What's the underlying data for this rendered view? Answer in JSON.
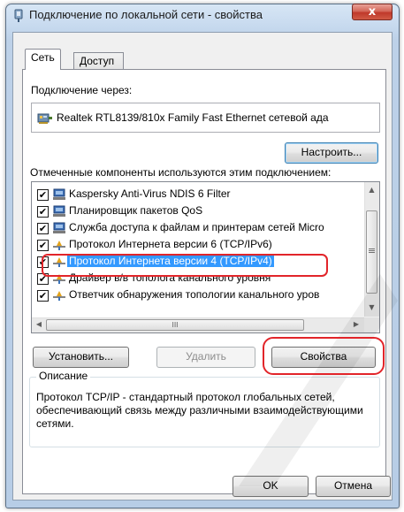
{
  "window": {
    "title": "Подключение по локальной сети - свойства",
    "close_glyph": "x"
  },
  "tabs": [
    {
      "label": "Сеть",
      "active": true
    },
    {
      "label": "Доступ",
      "active": false
    }
  ],
  "connection": {
    "label": "Подключение через:",
    "adapter": "Realtek RTL8139/810x Family Fast Ethernet сетевой ада",
    "configure_button": "Настроить..."
  },
  "components": {
    "label": "Отмеченные компоненты используются этим подключением:",
    "items": [
      {
        "label": "Kaspersky Anti-Virus NDIS 6 Filter",
        "checked": true,
        "icon": "network-client-icon",
        "selected": false
      },
      {
        "label": "Планировщик пакетов QoS",
        "checked": true,
        "icon": "network-client-icon",
        "selected": false
      },
      {
        "label": "Служба доступа к файлам и принтерам сетей Micro",
        "checked": true,
        "icon": "network-client-icon",
        "selected": false
      },
      {
        "label": "Протокол Интернета версии 6 (TCP/IPv6)",
        "checked": true,
        "icon": "protocol-icon",
        "selected": false
      },
      {
        "label": "Протокол Интернета версии 4 (TCP/IPv4)",
        "checked": true,
        "icon": "protocol-icon",
        "selected": true
      },
      {
        "label": "Драйвер в/в тополога канального уровня",
        "checked": true,
        "icon": "protocol-icon",
        "selected": false
      },
      {
        "label": "Ответчик обнаружения топологии канального уров",
        "checked": true,
        "icon": "protocol-icon",
        "selected": false
      }
    ],
    "check_glyph": "✔",
    "scroll_up": "▲",
    "scroll_down": "▼",
    "scroll_left": "◀",
    "scroll_right": "▶",
    "thumb_grip": "III",
    "vthumb_grip": "≡"
  },
  "buttons": {
    "install": "Установить...",
    "remove": "Удалить",
    "properties": "Свойства",
    "ok": "OK",
    "cancel": "Отмена"
  },
  "description": {
    "legend": "Описание",
    "text": "Протокол TCP/IP - стандартный протокол глобальных сетей, обеспечивающий связь между различными взаимодействующими сетями."
  },
  "colors": {
    "selection": "#3399ff",
    "highlight_ring": "#e2252a",
    "close_button": "#c0392b"
  }
}
